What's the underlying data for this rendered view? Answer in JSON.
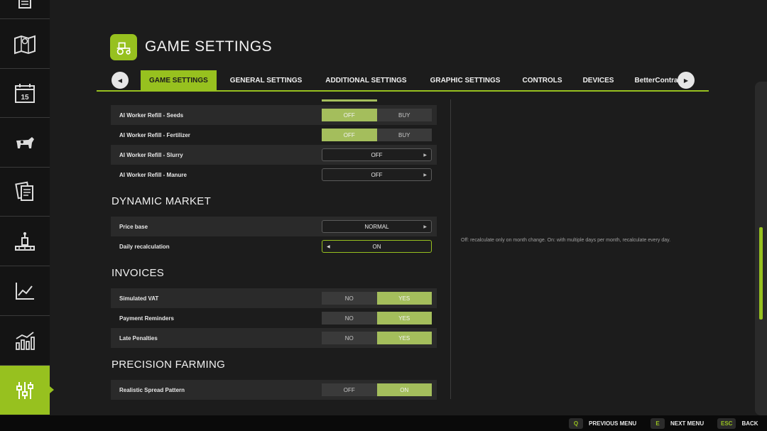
{
  "header": {
    "title": "GAME SETTINGS",
    "logo_icon": "tractor-icon"
  },
  "sidebar": {
    "items": [
      {
        "name": "notes-icon"
      },
      {
        "name": "map-icon"
      },
      {
        "name": "calendar-icon",
        "text": "15"
      },
      {
        "name": "animals-icon"
      },
      {
        "name": "contracts-icon"
      },
      {
        "name": "production-icon"
      },
      {
        "name": "prices-chart-icon"
      },
      {
        "name": "statistics-icon"
      },
      {
        "name": "settings-icon",
        "active": true
      }
    ]
  },
  "tabs": [
    {
      "label": "GAME SETTINGS",
      "active": true
    },
    {
      "label": "GENERAL SETTINGS"
    },
    {
      "label": "ADDITIONAL SETTINGS"
    },
    {
      "label": "GRAPHIC SETTINGS"
    },
    {
      "label": "CONTROLS"
    },
    {
      "label": "DEVICES"
    },
    {
      "label": "BetterContracts"
    }
  ],
  "settings": {
    "ai_refill": [
      {
        "label": "AI Worker Refill - Seeds",
        "type": "toggle",
        "options": [
          "OFF",
          "BUY"
        ],
        "selected": "OFF"
      },
      {
        "label": "AI Worker Refill - Fertilizer",
        "type": "toggle",
        "options": [
          "OFF",
          "BUY"
        ],
        "selected": "OFF"
      },
      {
        "label": "AI Worker Refill - Slurry",
        "type": "select",
        "value": "OFF"
      },
      {
        "label": "AI Worker Refill - Manure",
        "type": "select",
        "value": "OFF"
      }
    ],
    "dynamic_market": {
      "title": "DYNAMIC MARKET",
      "rows": [
        {
          "label": "Price base",
          "type": "select",
          "value": "NORMAL"
        },
        {
          "label": "Daily recalculation",
          "type": "select",
          "value": "ON",
          "focused": true
        }
      ]
    },
    "invoices": {
      "title": "INVOICES",
      "rows": [
        {
          "label": "Simulated VAT",
          "type": "toggle",
          "options": [
            "NO",
            "YES"
          ],
          "selected": "YES"
        },
        {
          "label": "Payment Reminders",
          "type": "toggle",
          "options": [
            "NO",
            "YES"
          ],
          "selected": "YES"
        },
        {
          "label": "Late Penalties",
          "type": "toggle",
          "options": [
            "NO",
            "YES"
          ],
          "selected": "YES"
        }
      ]
    },
    "precision_farming": {
      "title": "PRECISION FARMING",
      "rows": [
        {
          "label": "Realistic Spread Pattern",
          "type": "toggle",
          "options": [
            "OFF",
            "ON"
          ],
          "selected": "ON"
        }
      ]
    }
  },
  "help_text": "Off: recalculate only on month change. On: with multiple days per month, recalculate every day.",
  "footer": {
    "hints": [
      {
        "key": "Q",
        "label": "PREVIOUS MENU"
      },
      {
        "key": "E",
        "label": "NEXT MENU"
      },
      {
        "key": "ESC",
        "label": "BACK"
      }
    ]
  },
  "colors": {
    "accent": "#97c11f",
    "toggle_on": "#a4be5c",
    "background": "#1c1c1c"
  }
}
